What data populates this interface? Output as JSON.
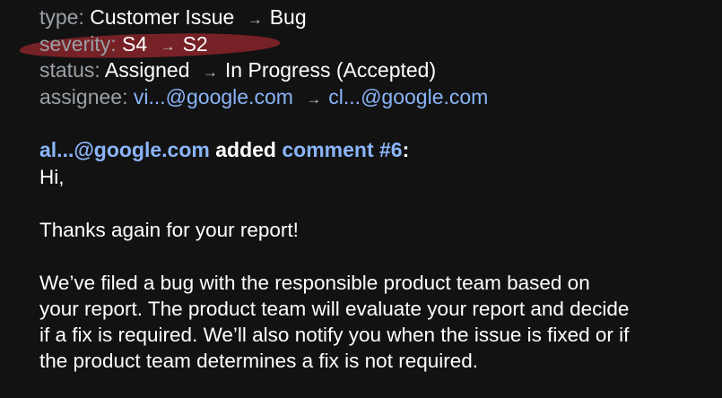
{
  "arrow": "→",
  "changes": {
    "type": {
      "label": "type:",
      "from": "Customer Issue",
      "to": "Bug"
    },
    "severity": {
      "label": "severity:",
      "from": "S4",
      "to": "S2"
    },
    "status": {
      "label": "status:",
      "from": "Assigned",
      "to": "In Progress (Accepted)"
    },
    "assignee": {
      "label": "assignee:",
      "from": "vi...@google.com",
      "to": "cl...@google.com"
    }
  },
  "comment": {
    "author": "al...@google.com",
    "action": "added",
    "link": "comment #6",
    "colon": ":",
    "greeting": "Hi,",
    "paragraph1": "Thanks again for your report!",
    "paragraph2_lines": [
      "We’ve filed a bug with the responsible product team based on",
      "your report. The product team will evaluate your report and decide",
      "if a fix is required. We’ll also notify you when the issue is fixed or if",
      "the product team determines a fix is not required."
    ]
  },
  "colors": {
    "background": "#121212",
    "link": "#8ab4f8",
    "label": "#9aa0a6",
    "highlight": "#c82d37"
  }
}
